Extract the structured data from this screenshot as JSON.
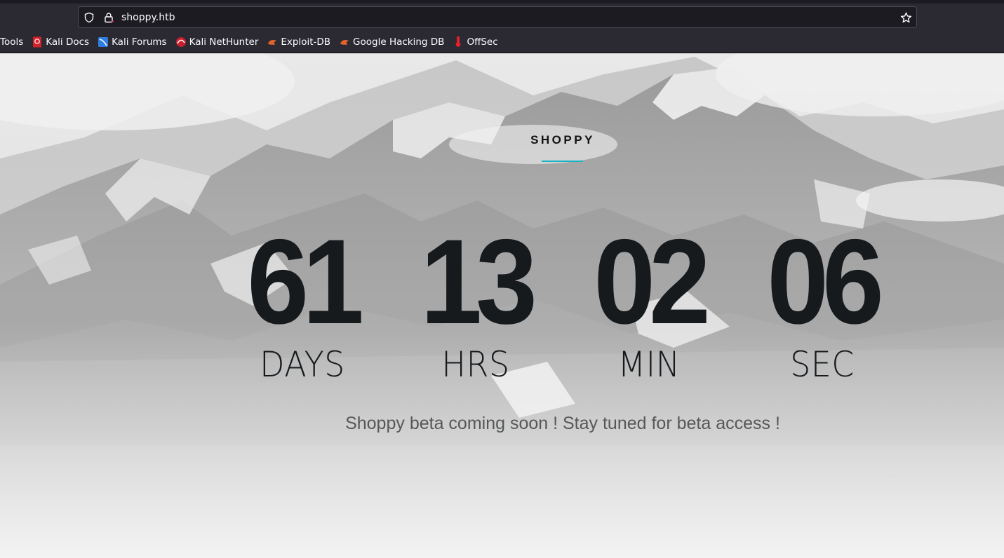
{
  "browser": {
    "url": "shoppy.htb",
    "bookmarks": [
      {
        "label": "Tools",
        "icon": "none"
      },
      {
        "label": "Kali Docs",
        "icon": "kali-docs-icon"
      },
      {
        "label": "Kali Forums",
        "icon": "kali-forums-icon"
      },
      {
        "label": "Kali NetHunter",
        "icon": "kali-nethunter-icon"
      },
      {
        "label": "Exploit-DB",
        "icon": "exploit-db-icon"
      },
      {
        "label": "Google Hacking DB",
        "icon": "ghdb-icon"
      },
      {
        "label": "OffSec",
        "icon": "offsec-icon"
      }
    ]
  },
  "page": {
    "brand": "SHOPPY",
    "accent_color": "#19b3c6",
    "countdown": [
      {
        "value": "61",
        "label": "DAYS"
      },
      {
        "value": "13",
        "label": "HRS"
      },
      {
        "value": "02",
        "label": "MIN"
      },
      {
        "value": "06",
        "label": "SEC"
      }
    ],
    "tagline": "Shoppy beta coming soon ! Stay tuned for beta access !"
  }
}
